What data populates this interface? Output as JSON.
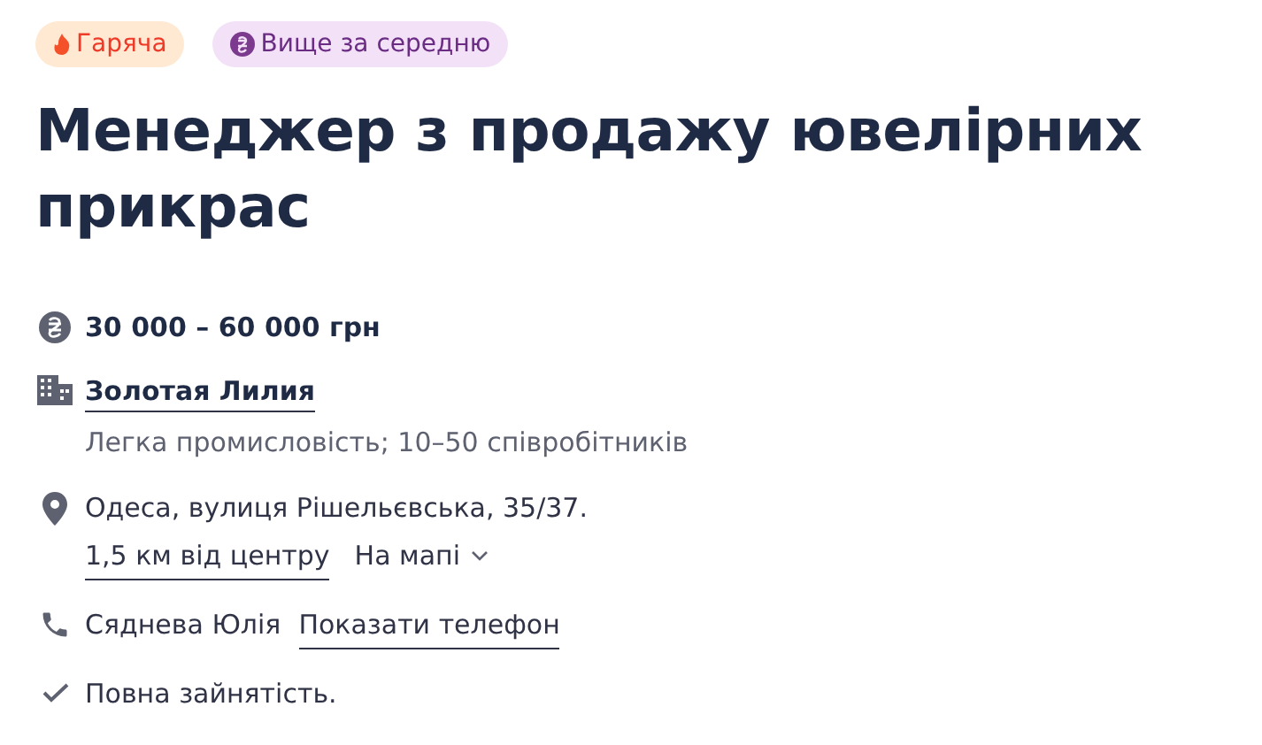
{
  "badges": [
    {
      "kind": "hot",
      "label": "Гаряча"
    },
    {
      "kind": "salary",
      "label": "Вище за середню"
    }
  ],
  "title": "Менеджер з продажу ювелірних прикрас",
  "salary": "30 000 – 60 000 грн",
  "company": {
    "name": "Золотая Лилия",
    "details": "Легка промисловість; 10–50 співробітників"
  },
  "address": {
    "text": "Одеса, вулиця Рішельєвська, 35/37.",
    "distance": "1,5 км від центру",
    "map_link": "На мапі"
  },
  "contact": {
    "name": "Сяднева Юлія",
    "phone_link": "Показати телефон"
  },
  "employment": "Повна зайнятість."
}
